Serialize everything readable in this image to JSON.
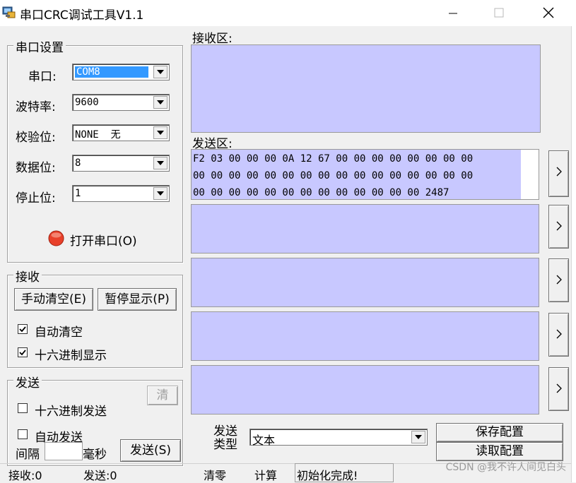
{
  "window": {
    "title": "串口CRC调试工具V1.1",
    "icon": "app-icon",
    "controls": [
      "minimize-icon",
      "maximize-icon",
      "close-icon"
    ]
  },
  "serial_settings": {
    "group_title": "串口设置",
    "port": {
      "label": "串口:",
      "value": "COM8"
    },
    "baud": {
      "label": "波特率:",
      "value": "9600"
    },
    "parity": {
      "label": "校验位:",
      "value": "NONE  无"
    },
    "databits": {
      "label": "数据位:",
      "value": "8"
    },
    "stopbits": {
      "label": "停止位:",
      "value": "1"
    },
    "open_button": {
      "label": "打开串口(O)",
      "icon": "stop-circle-icon",
      "status_color": "#e8402a"
    }
  },
  "receive_group": {
    "title": "接收",
    "clear_button": "手动清空(E)",
    "pause_button": "暂停显示(P)",
    "auto_clear": {
      "label": "自动清空",
      "checked": true
    },
    "hex_display": {
      "label": "十六进制显示",
      "checked": true
    }
  },
  "send_group": {
    "title": "发送",
    "clear_button": "清",
    "hex_send": {
      "label": "十六进制发送",
      "checked": false
    },
    "auto_send": {
      "label": "自动发送",
      "checked": false
    },
    "interval_label": "间隔",
    "interval_unit": "毫秒",
    "interval_value": "",
    "send_button": "发送(S)"
  },
  "receive_area": {
    "label": "接收区:",
    "content": ""
  },
  "send_area": {
    "label": "发送区:",
    "content": "F2 03 00 00 00 0A 12 67 00 00 00 00 00 00 00 00\n00 00 00 00 00 00 00 00 00 00 00 00 00 00 00 00\n00 00 00 00 00 00 00 00 00 00 00 00 00 2487",
    "side_button_icon": "chevron-right-icon"
  },
  "send_type": {
    "label_line1": "发送",
    "label_line2": "类型",
    "value": "文本"
  },
  "config_buttons": {
    "save": "保存配置",
    "load": "读取配置"
  },
  "status_bar": {
    "receive": "接收:0",
    "send": "发送:0",
    "clear": "清零",
    "calc": "计算",
    "message": "初始化完成!"
  },
  "watermark": "CSDN @我不许人间见白头",
  "colors": {
    "text_area_bg": "#c8c8ff",
    "window_bg": "#f0f0f0",
    "selection": "#3399ff"
  }
}
